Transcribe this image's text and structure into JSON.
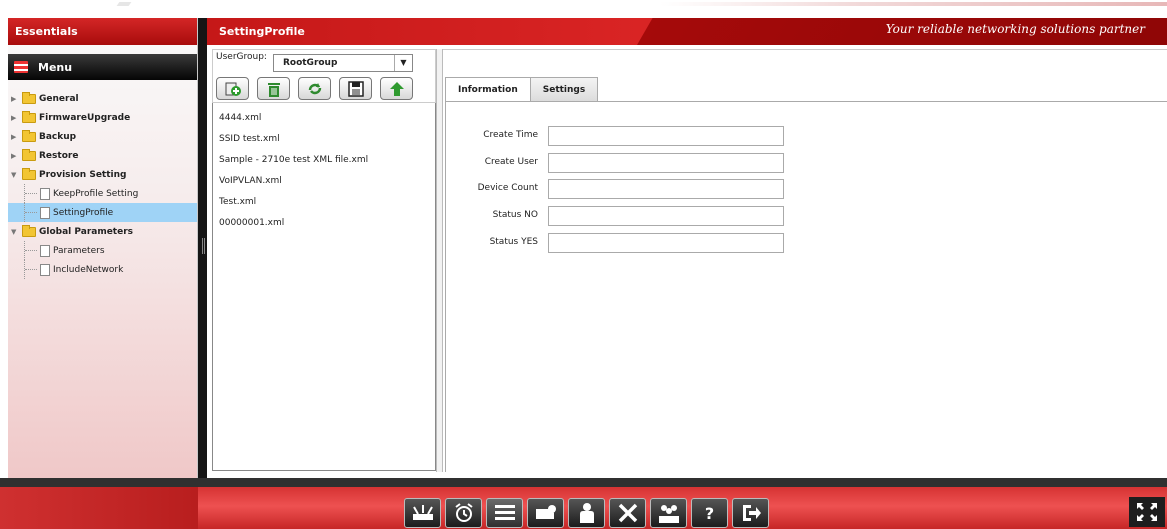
{
  "sidebar": {
    "header": "Essentials",
    "menu_label": "Menu",
    "tree": [
      {
        "label": "General",
        "type": "folder",
        "expanded": false
      },
      {
        "label": "FirmwareUpgrade",
        "type": "folder",
        "expanded": false
      },
      {
        "label": "Backup",
        "type": "folder",
        "expanded": false
      },
      {
        "label": "Restore",
        "type": "folder",
        "expanded": false
      },
      {
        "label": "Provision Setting",
        "type": "folder",
        "expanded": true
      },
      {
        "label": "KeepProfile Setting",
        "type": "leaf"
      },
      {
        "label": "SettingProfile",
        "type": "leaf",
        "selected": true
      },
      {
        "label": "Global Parameters",
        "type": "folder",
        "expanded": true
      },
      {
        "label": "Parameters",
        "type": "leaf"
      },
      {
        "label": "IncludeNetwork",
        "type": "leaf"
      }
    ]
  },
  "header": {
    "title": "SettingProfile",
    "tagline": "Your reliable networking solutions partner"
  },
  "filepanel": {
    "usergroup_label": "UserGroup:",
    "usergroup_value": "RootGroup",
    "toolbar_icons": [
      "add-file-icon",
      "delete-icon",
      "refresh-icon",
      "save-icon",
      "upload-icon"
    ],
    "files": [
      "4444.xml",
      "SSID test.xml",
      "Sample - 2710e test XML file.xml",
      "VoIPVLAN.xml",
      "Test.xml",
      "00000001.xml"
    ]
  },
  "detail": {
    "tabs": [
      {
        "label": "Information",
        "active": true
      },
      {
        "label": "Settings",
        "active": false
      }
    ],
    "fields": [
      {
        "label": "Create Time",
        "value": ""
      },
      {
        "label": "Create User",
        "value": ""
      },
      {
        "label": "Device Count",
        "value": ""
      },
      {
        "label": "Status NO",
        "value": ""
      },
      {
        "label": "Status YES",
        "value": ""
      }
    ]
  },
  "dock": {
    "icons": [
      "router-icon",
      "alarm-clock-icon",
      "list-icon",
      "network-icon",
      "user-icon",
      "tools-icon",
      "users-group-icon",
      "help-icon",
      "logout-icon"
    ]
  },
  "colors": {
    "brand_red": "#d42626",
    "selected_blue": "#9fd3f6"
  }
}
